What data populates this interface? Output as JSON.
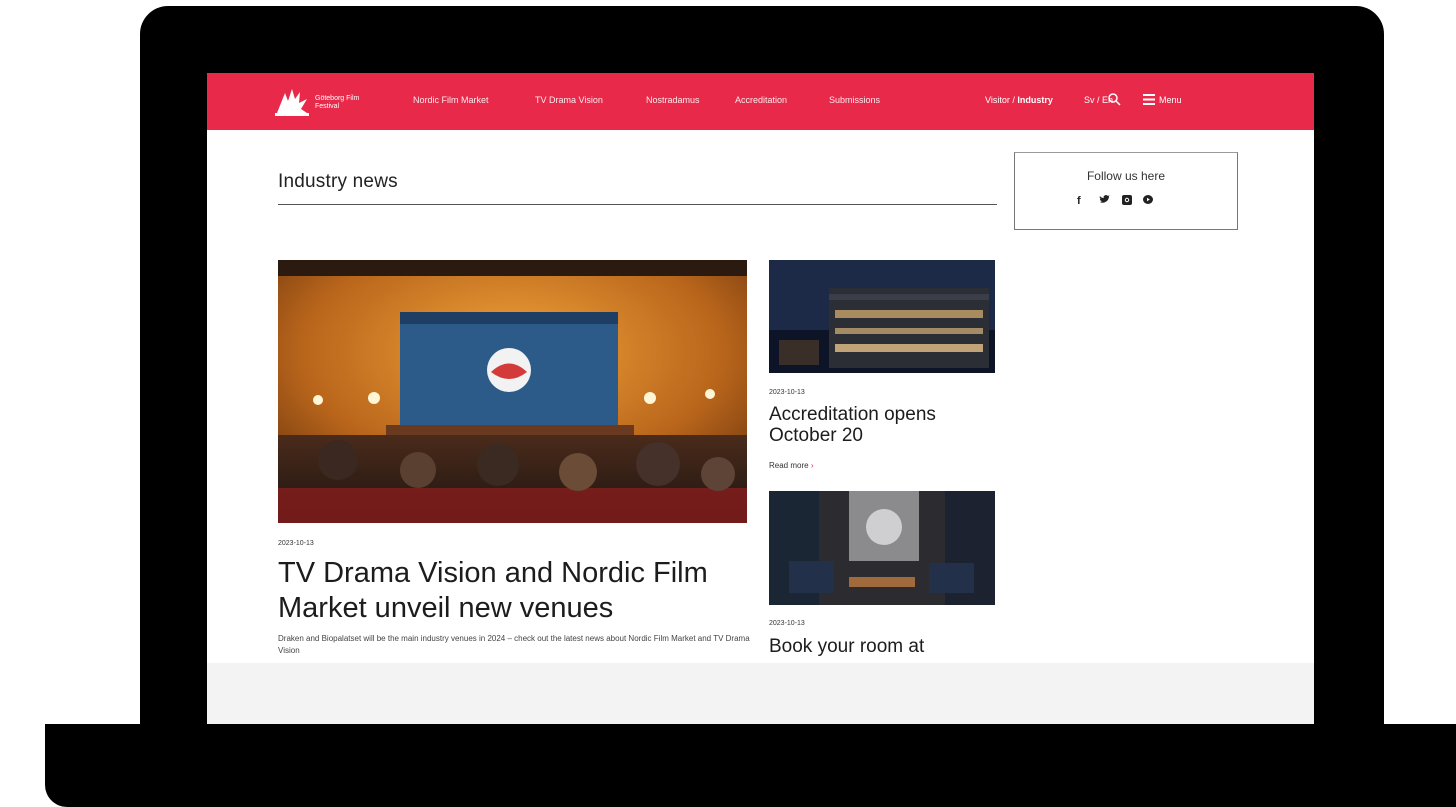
{
  "nav": {
    "logo_text": "Göteborg Film Festival",
    "items": [
      "Nordic Film Market",
      "TV Drama Vision",
      "Nostradamus",
      "Accreditation",
      "Submissions"
    ],
    "visitor_label": "Visitor",
    "industry_label": "Industry",
    "lang_sv": "Sv",
    "lang_en": "En",
    "menu_label": "Menu"
  },
  "section": {
    "title": "Industry news"
  },
  "follow": {
    "label": "Follow us here",
    "icons": [
      "facebook-icon",
      "twitter-icon",
      "instagram-icon",
      "youtube-icon"
    ]
  },
  "hero": {
    "date": "2023-10-13",
    "title": "TV Drama Vision and Nordic Film Market unveil new venues",
    "excerpt": "Draken and Biopalatset will be the main industry venues in 2024 – check out the latest news about Nordic Film Market and TV Drama Vision"
  },
  "cards": [
    {
      "date": "2023-10-13",
      "title": "Accreditation opens October 20",
      "read_more": "Read more"
    },
    {
      "date": "2023-10-13",
      "title": "Book your room at"
    }
  ],
  "colors": {
    "brand": "#e8294a"
  }
}
